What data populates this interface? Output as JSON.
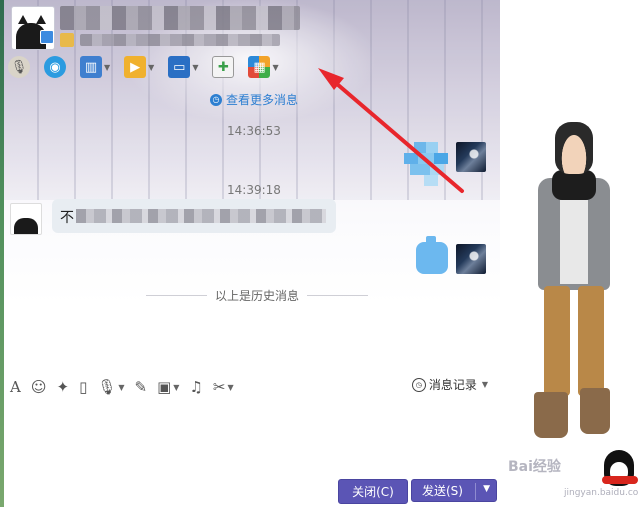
{
  "header": {
    "window_controls": [
      "▾",
      "—",
      "□",
      "✕"
    ]
  },
  "toolbar": {
    "items": [
      {
        "icon": "microphone-icon",
        "glyph": "🎙",
        "dropdown": false
      },
      {
        "icon": "video-icon",
        "glyph": "◉",
        "dropdown": false
      },
      {
        "icon": "app-icon",
        "glyph": "▥",
        "dropdown": true
      },
      {
        "icon": "folder-icon",
        "glyph": "▶",
        "dropdown": true
      },
      {
        "icon": "remote-icon",
        "glyph": "▭",
        "dropdown": true
      },
      {
        "icon": "note-add-icon",
        "glyph": "✚",
        "dropdown": false
      },
      {
        "icon": "apps-icon",
        "glyph": "▦",
        "dropdown": true
      }
    ]
  },
  "chat": {
    "more_messages": "查看更多消息",
    "timestamps": [
      "14:36:53",
      "14:39:18"
    ],
    "message_first_char": "不",
    "history_divider": "以上是历史消息"
  },
  "input_toolbar": {
    "history_label": "消息记录"
  },
  "buttons": {
    "close": "关闭(C)",
    "send": "发送(S)"
  },
  "watermark": {
    "text": "Bai经验",
    "sub": "jingyan.baidu.com"
  },
  "colors": {
    "accent": "#5b55b5",
    "link": "#2d7fd1",
    "annotation_arrow": "#e8262c"
  }
}
